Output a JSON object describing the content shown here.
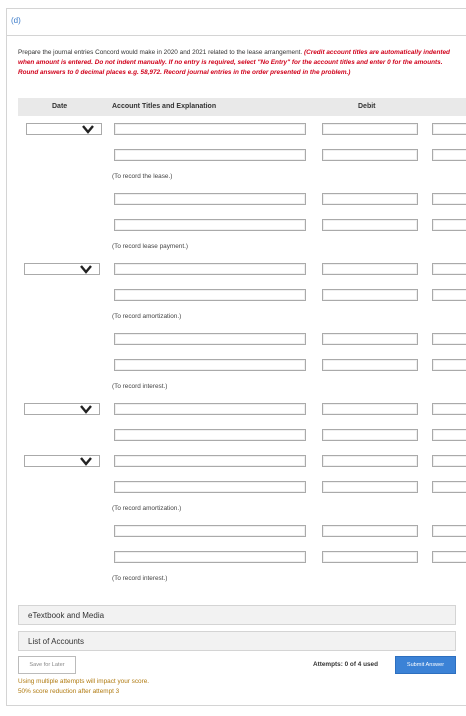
{
  "part_label": "(d)",
  "instructions": {
    "plain": "Prepare the journal entries Concord would make in 2020 and 2021 related to the lease arrangement. ",
    "red": "(Credit account titles are automatically indented when amount is entered. Do not indent manually. If no entry is required, select \"No Entry\" for the account titles and enter 0 for the amounts. Round answers to 0 decimal places e.g. 58,972. Record journal entries in the order presented in the problem.)"
  },
  "table_headers": {
    "date": "Date",
    "account": "Account Titles and Explanation",
    "debit": "Debit"
  },
  "entry_notes": [
    "(To record the lease.)",
    "(To record lease payment.)",
    "(To record amortization.)",
    "(To record interest.)",
    "(To record amortization.)",
    "(To record interest.)"
  ],
  "panels": {
    "etextbook": "eTextbook and Media",
    "accounts": "List of Accounts"
  },
  "buttons": {
    "save": "Save for Later",
    "submit": "Submit Answer"
  },
  "attempts": "Attempts: 0 of 4 used",
  "footnotes": {
    "line1": "Using multiple attempts will impact your score.",
    "line2": "50% score reduction after attempt 3"
  },
  "colors": {
    "accent_blue": "#3b82d6",
    "instruction_red": "#d0021b",
    "footnote_orange": "#b07a10"
  }
}
